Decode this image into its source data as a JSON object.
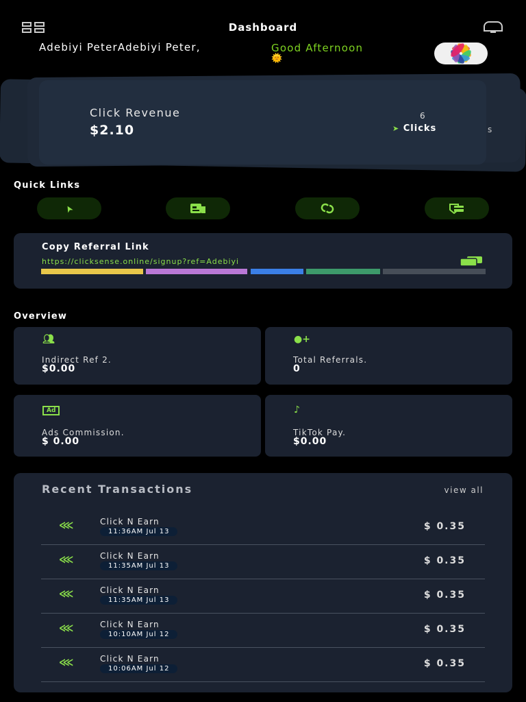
{
  "header": {
    "title": "Dashboard"
  },
  "greeting": {
    "name": "Adebiyi PeterAdebiyi Peter,",
    "message": "Good Afternoon",
    "emoji": "🌞"
  },
  "revenue_card": {
    "label": "Click Revenue",
    "value": "$2.10",
    "clicks_count": "6",
    "clicks_label": "Clicks",
    "behind_text": "s"
  },
  "quick_links": {
    "title": "Quick Links",
    "items": [
      {
        "icon": "cursor-icon"
      },
      {
        "icon": "wallet-icon"
      },
      {
        "icon": "link-icon"
      },
      {
        "icon": "card-shield-icon"
      }
    ]
  },
  "referral": {
    "title": "Copy Referral Link",
    "url": "https://clicksense.online/signup?ref=Adebiyi",
    "bar_colors": [
      "#e8c74a",
      "#b978d6",
      "#3b7fe6",
      "#3d9a6a",
      "#474e58"
    ]
  },
  "overview": {
    "title": "Overview",
    "cards": [
      {
        "label": "Indirect Ref 2.",
        "value": "$0.00",
        "icon": "users-icon"
      },
      {
        "label": "Total Referrals.",
        "value": "0",
        "icon": "user-plus-icon"
      },
      {
        "label": "Ads Commission.",
        "value": "$ 0.00",
        "icon": "ad-icon"
      },
      {
        "label": "TikTok Pay.",
        "value": "$0.00",
        "icon": "tiktok-icon"
      }
    ]
  },
  "transactions": {
    "title": "Recent Transactions",
    "view_all": "view all",
    "items": [
      {
        "title": "Click N Earn",
        "date": "11:36AM Jul 13",
        "amount": "$ 0.35"
      },
      {
        "title": "Click N Earn",
        "date": "11:35AM Jul 13",
        "amount": "$ 0.35"
      },
      {
        "title": "Click N Earn",
        "date": "11:35AM Jul 13",
        "amount": "$ 0.35"
      },
      {
        "title": "Click N Earn",
        "date": "10:10AM Jul 12",
        "amount": "$ 0.35"
      },
      {
        "title": "Click N Earn",
        "date": "10:06AM Jul 12",
        "amount": "$ 0.35"
      }
    ]
  }
}
